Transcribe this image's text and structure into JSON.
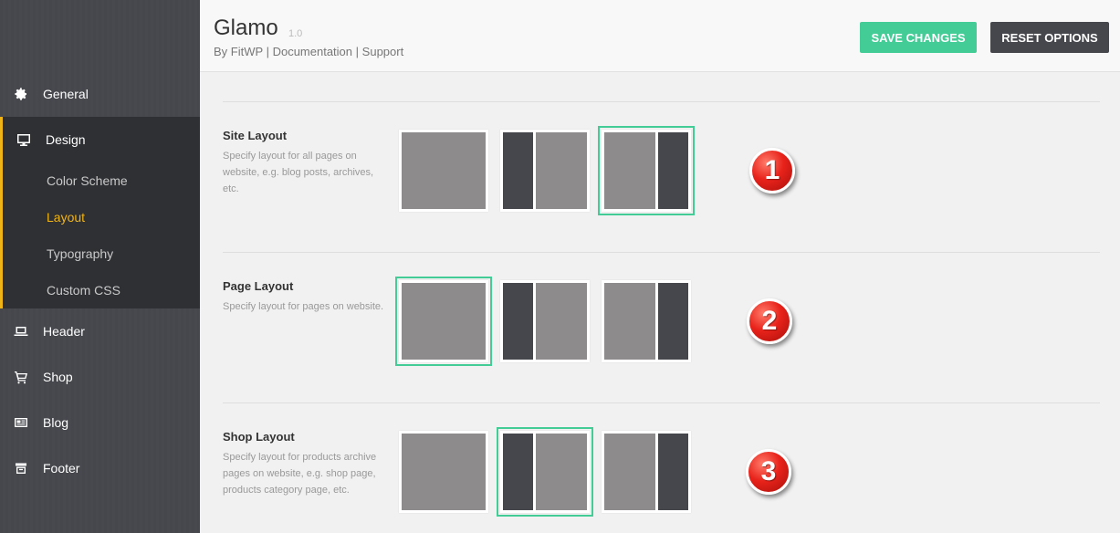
{
  "app": {
    "title": "Glamo",
    "version": "1.0",
    "by": "By FitWP",
    "sep": "|",
    "documentation": "Documentation",
    "support": "Support"
  },
  "toolbar": {
    "save_label": "SAVE CHANGES",
    "reset_label": "RESET OPTIONS"
  },
  "sidebar": {
    "general": "General",
    "design": "Design",
    "sub": {
      "color_scheme": "Color Scheme",
      "layout": "Layout",
      "typography": "Typography",
      "custom_css": "Custom CSS"
    },
    "header": "Header",
    "shop": "Shop",
    "blog": "Blog",
    "footer": "Footer"
  },
  "sections": {
    "site": {
      "title": "Site Layout",
      "desc": "Specify layout for all pages on website, e.g. blog posts, archives, etc.",
      "badge": "1",
      "selected": "content-sidebar"
    },
    "page": {
      "title": "Page Layout",
      "desc": "Specify layout for pages on website.",
      "badge": "2",
      "selected": "no-sidebar"
    },
    "shop": {
      "title": "Shop Layout",
      "desc": "Specify layout for products archive pages on website, e.g. shop page, products category page, etc.",
      "badge": "3",
      "selected": "sidebar-content"
    }
  },
  "colors": {
    "accent": "#44cc96",
    "active_nav": "#f2b414",
    "sidebar_bg": "#45474c",
    "dark_button": "#46474c"
  }
}
